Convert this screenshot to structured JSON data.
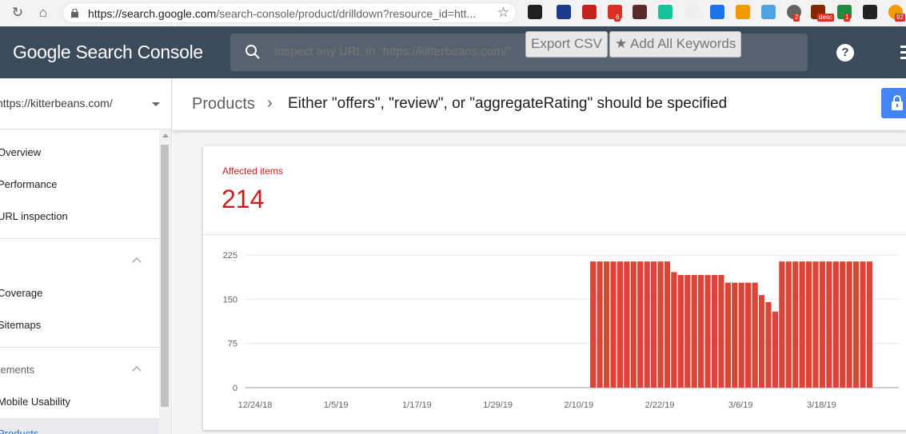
{
  "browser": {
    "url_main": "https://search.google.com",
    "url_path": "/search-console/product/drilldown?resource_id=htt...",
    "extensions": [
      {
        "name": "ext-film-icon",
        "color": "#202124",
        "badge": ""
      },
      {
        "name": "ext-x-icon",
        "color": "#1a3a8a",
        "badge": ""
      },
      {
        "name": "ext-chart-icon",
        "color": "#c5221f",
        "badge": ""
      },
      {
        "name": "ext-calendar-icon",
        "color": "#d93025",
        "badge": "6"
      },
      {
        "name": "ext-k-icon",
        "color": "#5a2a2a",
        "badge": ""
      },
      {
        "name": "ext-grammarly-icon",
        "color": "#15c39a",
        "badge": ""
      },
      {
        "name": "ext-amz-icon",
        "color": "#eeeeee",
        "badge": ""
      },
      {
        "name": "ext-eye-icon",
        "color": "#1a73e8",
        "badge": ""
      },
      {
        "name": "ext-drop-icon",
        "color": "#f29900",
        "badge": ""
      },
      {
        "name": "ext-bowtie-icon",
        "color": "#4fa3e0",
        "badge": ""
      },
      {
        "name": "ext-gear-icon",
        "color": "#5f6368",
        "badge": "2"
      },
      {
        "name": "ext-desc-icon",
        "color": "#8b2500",
        "badge": "desc"
      },
      {
        "name": "ext-grid-icon",
        "color": "#1e8e3e",
        "badge": "1"
      },
      {
        "name": "ext-check-icon",
        "color": "#202124",
        "badge": ""
      },
      {
        "name": "ext-cursor-icon",
        "color": "#f29900",
        "badge": "92"
      }
    ]
  },
  "header": {
    "logo": "Google Search Console",
    "search_placeholder": "Inspect any URL in \"https://kitterbeans.com/\"",
    "export_csv": "Export CSV",
    "add_keywords": "Add All Keywords"
  },
  "sidebar": {
    "property": "https://kitterbeans.com/",
    "items": [
      "Overview",
      "Performance",
      "URL inspection"
    ],
    "index_items": [
      "Coverage",
      "Sitemaps"
    ],
    "enhancements_label": "cements",
    "enh_items": [
      "Mobile Usability"
    ],
    "products": "Products"
  },
  "main": {
    "breadcrumb_parent": "Products",
    "breadcrumb_sep": "›",
    "breadcrumb_current": "Either \"offers\", \"review\", or \"aggregateRating\" should be specified",
    "affected_label": "Affected items",
    "affected_value": "214"
  },
  "chart_data": {
    "type": "bar",
    "title": "",
    "xlabel": "",
    "ylabel": "",
    "ylim": [
      0,
      225
    ],
    "y_ticks": [
      "225",
      "150",
      "75",
      "0"
    ],
    "x_ticks": [
      "12/24/18",
      "1/5/19",
      "1/17/19",
      "1/29/19",
      "2/10/19",
      "2/22/19",
      "3/6/19",
      "3/18/19"
    ],
    "bar_color": "#db4437",
    "start_date": "12/24/18",
    "bar_start_date": "2/13/19",
    "values": [
      214,
      214,
      214,
      214,
      214,
      214,
      214,
      214,
      214,
      214,
      214,
      214,
      196,
      191,
      191,
      191,
      191,
      191,
      191,
      191,
      178,
      178,
      178,
      178,
      178,
      157,
      145,
      129,
      214,
      214,
      214,
      214,
      214,
      214,
      214,
      214,
      214,
      214,
      214,
      214,
      214,
      214
    ]
  }
}
